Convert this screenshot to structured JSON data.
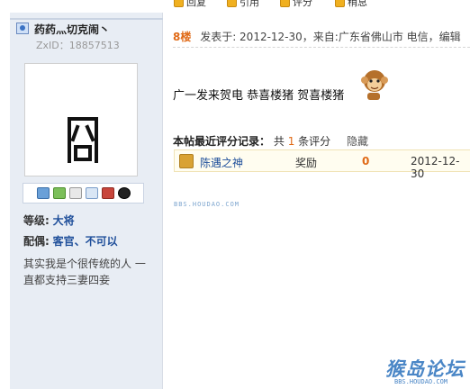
{
  "toolbar": {
    "reply_label": "回复",
    "quote_label": "引用",
    "rate_label": "评分",
    "report_label": "稍息"
  },
  "user": {
    "name": "药药灬切克闹丶",
    "id_text": "ZxID：18857513",
    "rank_key": "等级:",
    "rank_value": "大将",
    "spouse_key": "配偶:",
    "spouse_value": "客官、不可以",
    "bio": "其实我是个很传统的人 一直都支持三妻四妾"
  },
  "post": {
    "floor": "8楼",
    "meta": "发表于: 2012-12-30，来自:广东省佛山市 电信，编辑",
    "content": "广一发来贺电 恭喜楼猪 贺喜楼猪"
  },
  "rating": {
    "title": "本帖最近评分记录：",
    "count_prefix": "共",
    "count": "1",
    "count_suffix": "条评分",
    "hide_label": "隐藏",
    "row": {
      "user": "陈遇之神",
      "action": "奖励",
      "value": "0",
      "date": "2012-12-30"
    }
  },
  "watermark": {
    "small": "BBS.HOUDAO.COM",
    "big_cn": "猴岛论坛",
    "big_en": "BBS.HOUDAO.COM"
  }
}
